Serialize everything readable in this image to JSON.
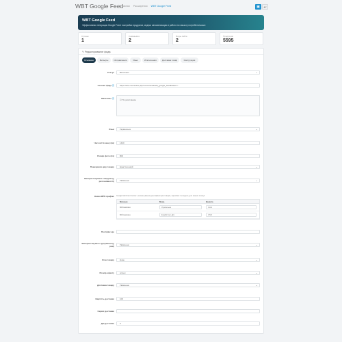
{
  "header": {
    "title": "WBT Google Feed",
    "breadcrumbs": [
      "Главная",
      "Расширения",
      "WBT Google Feed"
    ],
    "save_icon": "save-icon",
    "back_icon": "reply-icon"
  },
  "hero": {
    "title": "WBT Google Feed",
    "subtitle": "Эффективная генерация Google Feed: настройки продуктов, индекс автоматизации и работа по смыслу потребительских"
  },
  "stats": [
    {
      "label": "Страны",
      "value": "1"
    },
    {
      "label": "Самовывоз",
      "value": "2"
    },
    {
      "label": "Фиды сайта",
      "value": "2"
    },
    {
      "label": "Продукции",
      "value": "5595"
    }
  ],
  "card": {
    "title": "Редактирование фида",
    "tabs": [
      "Основное",
      "Фильтры",
      "Исправления",
      "Язык",
      "Исключения",
      "Доставка товар",
      "Инструкция"
    ],
    "fields": {
      "status": {
        "label": "Статус",
        "value": "Включено"
      },
      "feed_link": {
        "label": "Ссылка фида",
        "value": "https://site.com/index.php?route=feed/wbt_google_feed&token=..."
      },
      "stores": {
        "label": "Магазины",
        "checkbox": "По умолчанию"
      },
      "lang": {
        "label": "Язык",
        "value": "Украинська"
      },
      "cache_time": {
        "label": "Час життя кешу (хв)",
        "value": "1440"
      },
      "code_length": {
        "label": "Розмір фото (пх)",
        "value": "800"
      },
      "price_type": {
        "label": "Показувати ціну товару",
        "value": "Ціна без акцій"
      },
      "fallback_price": {
        "label": "Використовувати спецціни (у разі наявності)",
        "value": "Увімкнено"
      },
      "mpn_help": "Google Merchant Center: налаштування ідентифікаторів товарів, виробник та модель для кожної позиції",
      "table_heads": [
        "Магазин",
        "Мова",
        "Валюта"
      ],
      "table_rows": [
        {
          "store": "Мій магазин",
          "lang": "Українська",
          "currency": "UAH"
        },
        {
          "store": "Мій магазин",
          "lang": "English (en-gb)",
          "currency": "USD"
        }
      ],
      "fixed_rows": {
        "label": "Назва MPN префікс"
      },
      "suffix": {
        "label": "Постфікс цін",
        "value": ""
      },
      "group_id": {
        "label": "Використовувати групування (у разі)",
        "value": "Увімкнено"
      },
      "condition": {
        "label": "Стан товару",
        "value": "Нове"
      },
      "gender": {
        "label": "Розмір ефекту",
        "value": "unisex"
      },
      "delivery": {
        "label": "Доставка товару",
        "value": "Увімкнено"
      },
      "shipping_price": {
        "label": "Вартість доставки",
        "value": "100"
      },
      "shipping_service": {
        "label": "Сервіс доставки",
        "value": ""
      },
      "shipping_time": {
        "label": "Дні доставки",
        "value": "3"
      }
    }
  }
}
